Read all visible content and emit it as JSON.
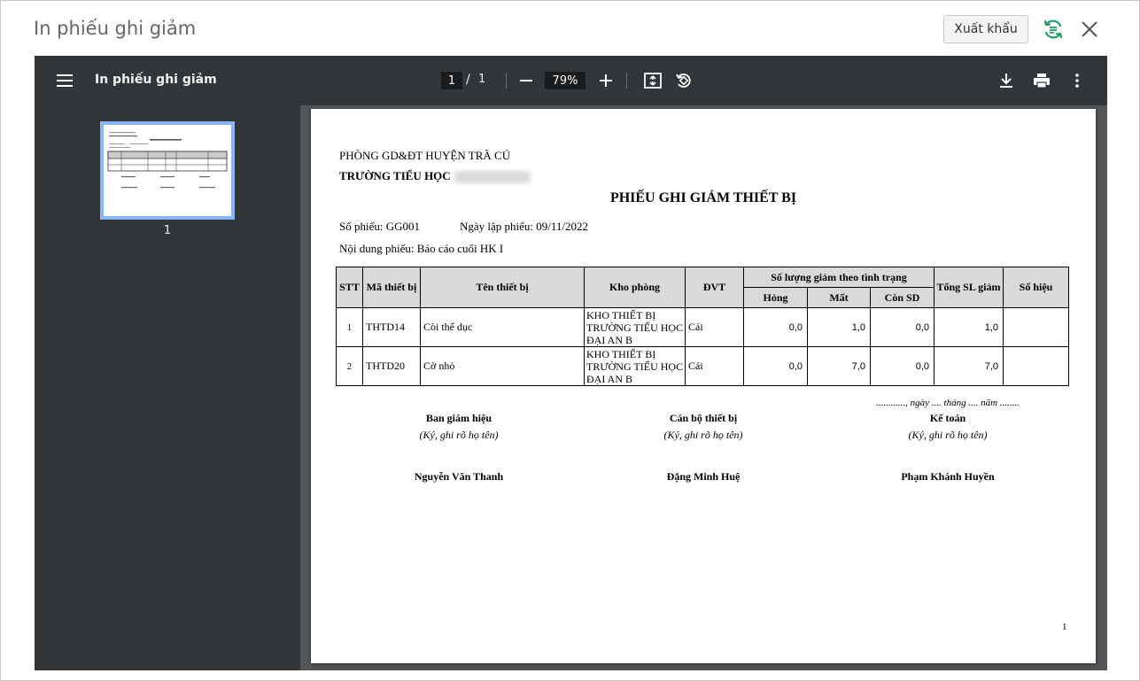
{
  "dialog": {
    "title": "In phiếu ghi giảm",
    "export_label": "Xuất khẩu"
  },
  "viewer": {
    "doc_title": "In phiếu ghi giảm",
    "current_page": "1",
    "page_sep": "/",
    "total_pages": "1",
    "zoom": "79%",
    "thumb_label": "1"
  },
  "doc": {
    "dept": "PHÒNG GD&ĐT HUYỆN TRÀ CÚ",
    "school": "TRƯỜNG TIỂU HỌC",
    "title": "PHIẾU GHI GIẢM THIẾT BỊ",
    "so_phieu": "Số phiếu: GG001",
    "ngay_lap": "Ngày lập phiếu: 09/11/2022",
    "noi_dung": "Nội dung phiếu: Báo cáo cuối HK I",
    "headers": {
      "stt": "STT",
      "ma": "Mã thiết bị",
      "ten": "Tên thiết bị",
      "kho": "Kho phòng",
      "dvt": "ĐVT",
      "group": "Số lượng giảm theo tình trạng",
      "hong": "Hỏng",
      "mat": "Mất",
      "con": "Còn SD",
      "tong": "Tổng SL giảm",
      "sohieu": "Số hiệu"
    },
    "rows": [
      {
        "stt": "1",
        "ma": "THTD14",
        "ten": "Còi thể dục",
        "kho": "KHO THIẾT BỊ TRƯỜNG TIỂU HỌC ĐẠI AN B",
        "dvt": "Cái",
        "hong": "0,0",
        "mat": "1,0",
        "con": "0,0",
        "tong": "1,0",
        "sohieu": ""
      },
      {
        "stt": "2",
        "ma": "THTD20",
        "ten": "Cờ nhỏ",
        "kho": "KHO THIẾT BỊ TRƯỜNG TIỂU HỌC ĐẠI AN B",
        "dvt": "Cái",
        "hong": "0,0",
        "mat": "7,0",
        "con": "0,0",
        "tong": "7,0",
        "sohieu": ""
      }
    ],
    "date_line": "............, ngày .... tháng .... năm ........",
    "sign": [
      {
        "role": "Ban giám hiệu",
        "note": "(Ký, ghi rõ họ tên)",
        "name": "Nguyễn Văn Thanh"
      },
      {
        "role": "Cán bộ thiết bị",
        "note": "(Ký, ghi rõ họ tên)",
        "name": "Đặng Minh Huệ"
      },
      {
        "role": "Kế toán",
        "note": "(Ký, ghi rõ họ tên)",
        "name": "Phạm Khánh Huyền"
      }
    ],
    "page_number": "1"
  },
  "icons": {
    "menu": "menu-icon",
    "minus": "minus-icon",
    "plus": "plus-icon",
    "fit": "fit-page-icon",
    "rotate": "rotate-icon",
    "download": "download-icon",
    "print": "print-icon",
    "more": "more-vert-icon",
    "refresh": "refresh-icon",
    "close": "close-icon"
  },
  "colors": {
    "toolbar": "#323639",
    "viewer_bg": "#525659",
    "thumb_border": "#8ab4f8",
    "refresh_icon": "#1aa260",
    "table_header": "#d9d9d9"
  }
}
